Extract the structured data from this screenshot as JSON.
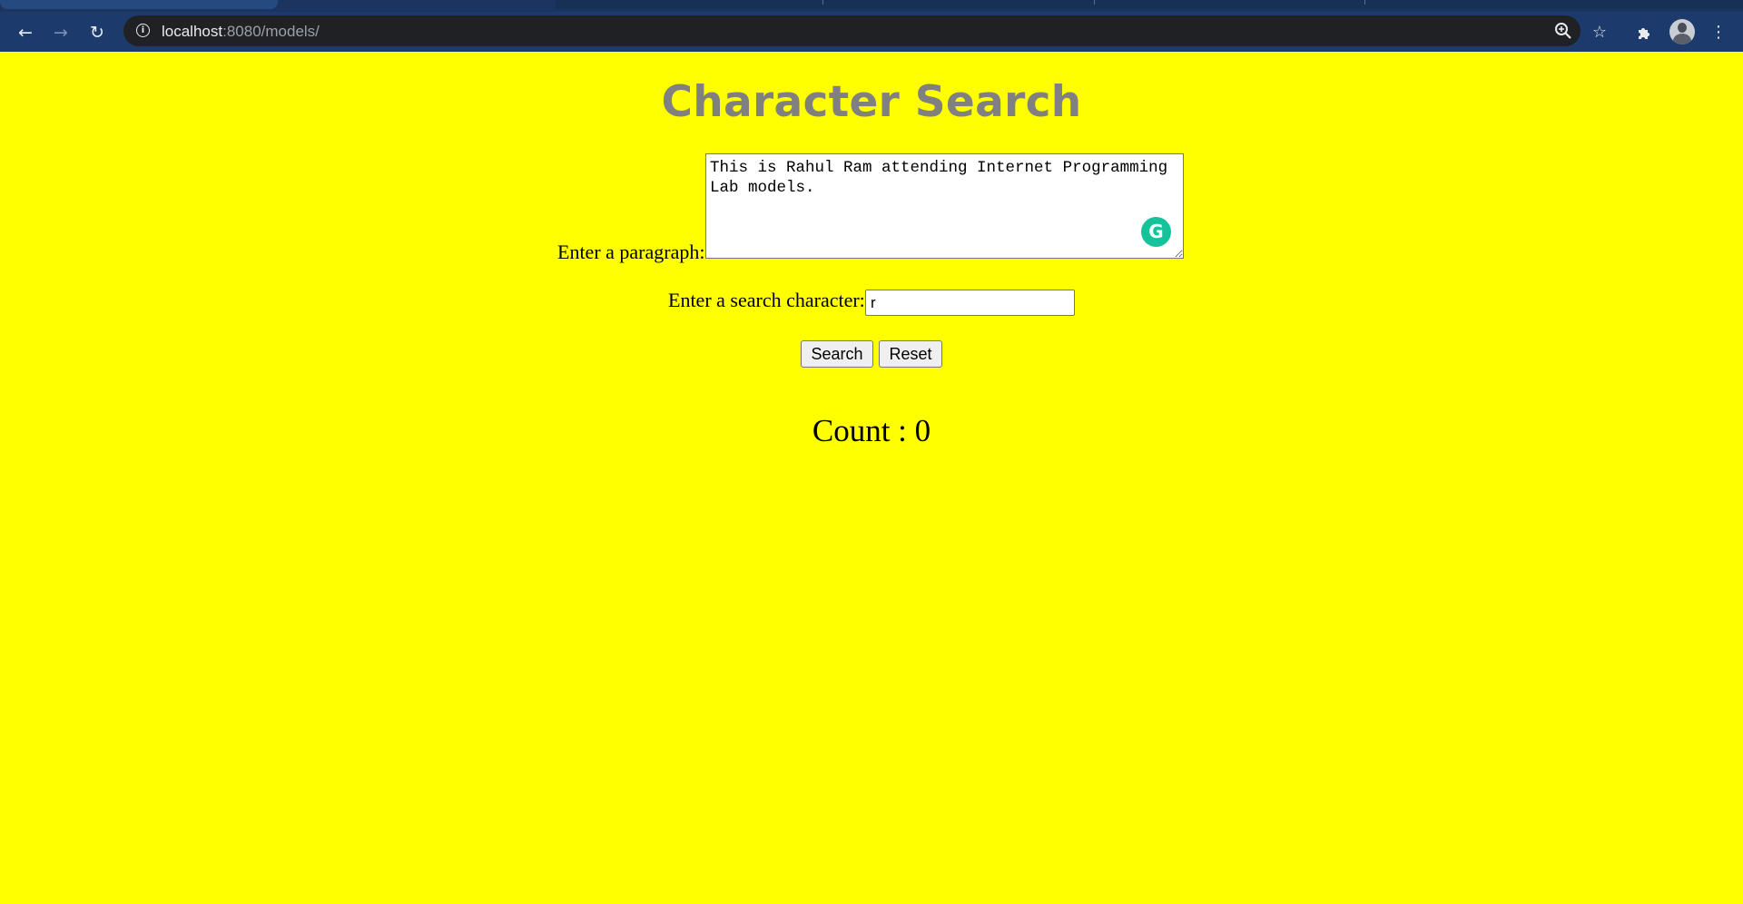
{
  "browser": {
    "url_host": "localhost",
    "url_rest": ":8080/models/",
    "colors": {
      "chrome": "#1c3a6b",
      "omnibox": "#202124"
    }
  },
  "page": {
    "background": "#ffff00",
    "title": "Character Search",
    "title_color": "#808080",
    "paragraph_label": "Enter a paragraph:",
    "paragraph_value": "This is Rahul Ram attending Internet Programming Lab models.",
    "search_char_label": "Enter a search character:",
    "search_char_value": "r",
    "search_button": "Search",
    "reset_button": "Reset",
    "count_text": "Count : 0"
  },
  "icons": {
    "back": "back-arrow-icon",
    "forward": "forward-arrow-icon",
    "reload": "reload-icon",
    "info": "info-icon",
    "zoom": "zoom-icon",
    "bookmark": "bookmark-star-icon",
    "extensions": "extensions-puzzle-icon",
    "profile": "profile-avatar",
    "menu": "kebab-menu-icon",
    "grammarly": "grammarly-icon"
  }
}
